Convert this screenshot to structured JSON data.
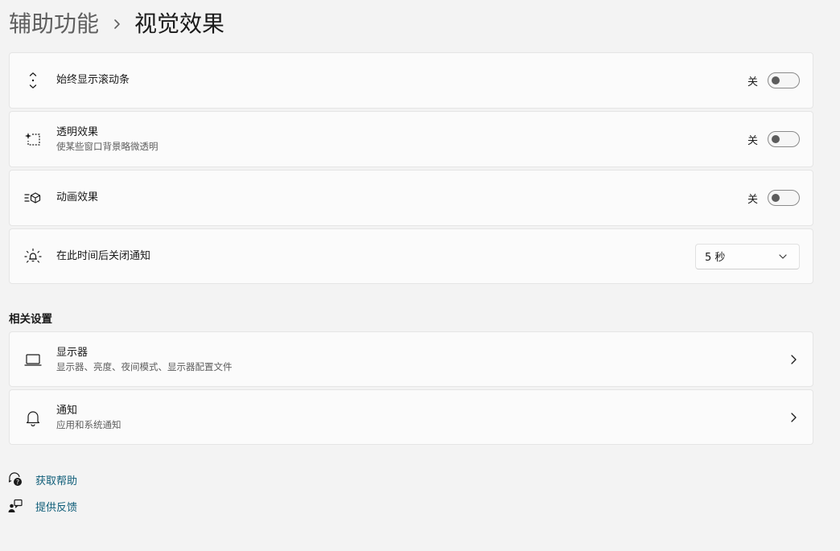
{
  "breadcrumb": {
    "parent": "辅助功能",
    "separator": "›",
    "current": "视觉效果"
  },
  "settings": [
    {
      "title": "始终显示滚动条",
      "description": "",
      "icon": "scrollbar-arrows-icon",
      "control": "toggle",
      "state_label": "关",
      "on": false
    },
    {
      "title": "透明效果",
      "description": "使某些窗口背景略微透明",
      "icon": "transparency-sparkle-icon",
      "control": "toggle",
      "state_label": "关",
      "on": false
    },
    {
      "title": "动画效果",
      "description": "",
      "icon": "animation-cube-icon",
      "control": "toggle",
      "state_label": "关",
      "on": false
    },
    {
      "title": "在此时间后关闭通知",
      "description": "",
      "icon": "notification-timer-icon",
      "control": "dropdown",
      "value": "5 秒"
    }
  ],
  "related": {
    "heading": "相关设置",
    "items": [
      {
        "title": "显示器",
        "description": "显示器、亮度、夜间模式、显示器配置文件",
        "icon": "laptop-display-icon"
      },
      {
        "title": "通知",
        "description": "应用和系统通知",
        "icon": "bell-icon"
      }
    ]
  },
  "footer": {
    "help_label": "获取帮助",
    "feedback_label": "提供反馈"
  },
  "colors": {
    "background": "#f3f3f3",
    "card": "#fbfbfb",
    "link": "#0f5d78",
    "toggle_knob": "#5c5c5c"
  }
}
